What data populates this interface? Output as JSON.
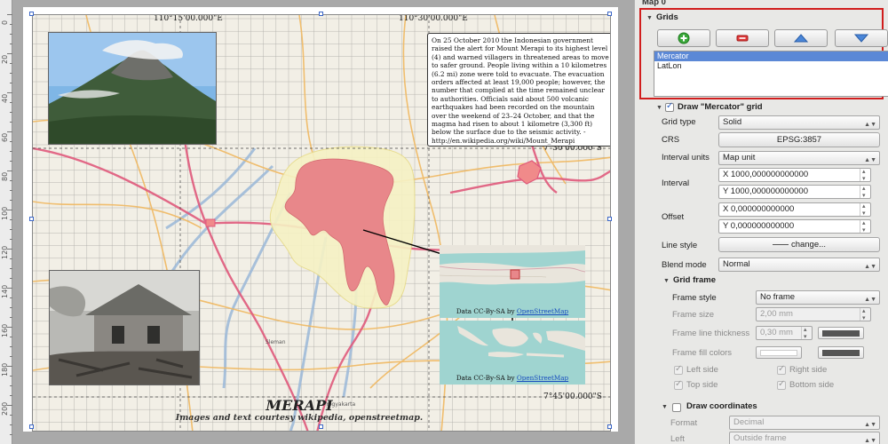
{
  "canvas": {
    "ruler_labels": [
      "0",
      "20",
      "40",
      "60",
      "80",
      "100",
      "120",
      "140",
      "160",
      "180",
      "200"
    ],
    "coord_labels": {
      "top_left": "110°15'00.000\"E",
      "top_right": "110°30'00.000\"E",
      "right_upper": "7°30'00.000\"S",
      "right_lower": "7°45'00.000\"S"
    },
    "map_labels": [
      "Sleman",
      "Yogyakarta"
    ],
    "description_text": "On 25 October 2010 the Indonesian government raised the alert for Mount Merapi to its highest level (4) and warned villagers in threatened areas to move to safer ground. People living within a 10 kilometres (6.2 mi) zone were told to evacuate. The evacuation orders affected at least 19,000 people; however, the number that complied at the time remained unclear to authorities. Officials said about 500 volcanic earthquakes had been recorded on the mountain over the weekend of 23–24 October, and that the magma had risen to about 1 kilometre (3,300 ft) below the surface due to the seismic activity. - http://en.wikipedia.org/wiki/Mount_Merapi",
    "inset1_caption_prefix": "Data CC-By-SA by ",
    "inset1_caption_link": "OpenStreetMap",
    "inset2_caption_prefix": "Data CC-By-SA by ",
    "inset2_caption_link": "OpenStreetMap",
    "title": "MERAPI",
    "subtitle": "Images and text courtesy wikipedia, openstreetmap."
  },
  "panel": {
    "header": "Map 0",
    "grids": {
      "title": "Grids",
      "buttons": [
        "add-grid",
        "remove-grid",
        "move-up",
        "move-down"
      ],
      "items": [
        "Mercator",
        "LatLon"
      ],
      "selected_index": 0
    },
    "draw_grid": {
      "label": "Draw \"Mercator\" grid",
      "checked": true
    },
    "grid_type": {
      "label": "Grid type",
      "value": "Solid"
    },
    "crs": {
      "label": "CRS",
      "value": "EPSG:3857"
    },
    "interval_units": {
      "label": "Interval units",
      "value": "Map unit"
    },
    "interval": {
      "label": "Interval",
      "x": "X 1000,000000000000",
      "y": "Y 1000,000000000000"
    },
    "offset": {
      "label": "Offset",
      "x": "X 0,000000000000",
      "y": "Y 0,000000000000"
    },
    "line_style": {
      "label": "Line style",
      "button": "change..."
    },
    "blend_mode": {
      "label": "Blend mode",
      "value": "Normal"
    },
    "grid_frame": {
      "title": "Grid frame",
      "frame_style": {
        "label": "Frame style",
        "value": "No frame"
      },
      "frame_size": {
        "label": "Frame size",
        "value": "2,00 mm"
      },
      "frame_line_thickness": {
        "label": "Frame line thickness",
        "value": "0,30 mm"
      },
      "frame_fill_colors": {
        "label": "Frame fill colors"
      },
      "left_side": {
        "label": "Left side",
        "checked": true
      },
      "right_side": {
        "label": "Right side",
        "checked": true
      },
      "top_side": {
        "label": "Top side",
        "checked": true
      },
      "bottom_side": {
        "label": "Bottom side",
        "checked": true
      }
    },
    "draw_coordinates": {
      "label": "Draw coordinates",
      "checked": false
    },
    "format": {
      "label": "Format",
      "value": "Decimal"
    },
    "left": {
      "label": "Left",
      "value": "Outside frame"
    }
  },
  "colors": {
    "selection_blue": "#5b88d6",
    "highlight_red": "#d11e1e",
    "lava_fill": "#e8878a",
    "zone_fill": "#f6f2c4",
    "sea": "#9fd4d0",
    "road_pink": "#e05a7c",
    "road_orange": "#f0b860",
    "river_blue": "#9bb8d8"
  }
}
